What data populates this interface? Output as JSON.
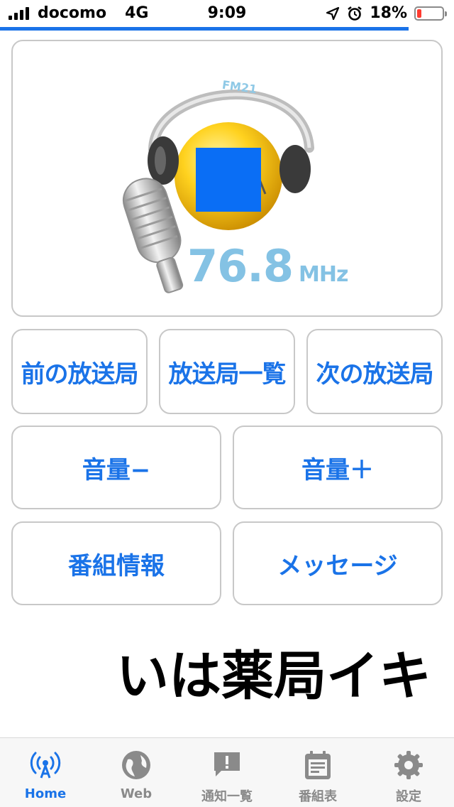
{
  "status_bar": {
    "carrier": "docomo",
    "network": "4G",
    "time": "9:09",
    "battery_percent": "18%",
    "battery_level": 0.18,
    "icons": [
      "signal-bars-icon",
      "location-arrow-icon",
      "alarm-clock-icon",
      "battery-icon"
    ]
  },
  "page_load_progress": 0.9,
  "station": {
    "logo_text": "FM21",
    "frequency": "76.8",
    "frequency_unit": "MHz"
  },
  "controls": {
    "prev_station": "前の放送局",
    "station_list": "放送局一覧",
    "next_station": "次の放送局",
    "volume_down": "音量−",
    "volume_up": "音量＋",
    "program_info": "番組情報",
    "message": "メッセージ"
  },
  "ticker_text": "いは薬局イキ",
  "tabs": [
    {
      "label": "Home",
      "icon": "broadcast-icon",
      "active": true
    },
    {
      "label": "Web",
      "icon": "globe-icon",
      "active": false
    },
    {
      "label": "通知一覧",
      "icon": "chat-alert-icon",
      "active": false
    },
    {
      "label": "番組表",
      "icon": "calendar-icon",
      "active": false
    },
    {
      "label": "設定",
      "icon": "gear-icon",
      "active": false
    }
  ],
  "colors": {
    "accent": "#1a73e8",
    "inactive": "#8a8a8a",
    "battery_low": "#ff3b30",
    "frequency_text": "#84c2e4"
  }
}
